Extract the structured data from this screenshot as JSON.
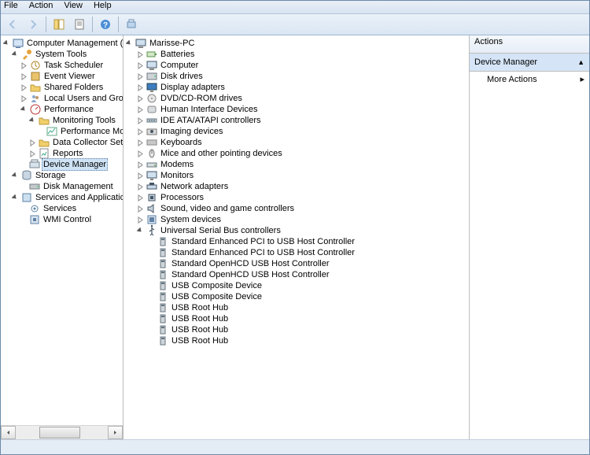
{
  "menu": {
    "file": "File",
    "action": "Action",
    "view": "View",
    "help": "Help"
  },
  "actions": {
    "header": "Actions",
    "section": "Device Manager",
    "more": "More Actions"
  },
  "left": {
    "root": "Computer Management (Local",
    "systools": "System Tools",
    "tasks": "Task Scheduler",
    "events": "Event Viewer",
    "shared": "Shared Folders",
    "users": "Local Users and Groups",
    "perf": "Performance",
    "montools": "Monitoring Tools",
    "perfmon": "Performance Mo",
    "datacol": "Data Collector Sets",
    "reports": "Reports",
    "devmgr": "Device Manager",
    "storage": "Storage",
    "diskmgmt": "Disk Management",
    "services": "Services and Applications",
    "svcs": "Services",
    "wmi": "WMI Control"
  },
  "center": {
    "root": "Marisse-PC",
    "cats": [
      "Batteries",
      "Computer",
      "Disk drives",
      "Display adapters",
      "DVD/CD-ROM drives",
      "Human Interface Devices",
      "IDE ATA/ATAPI controllers",
      "Imaging devices",
      "Keyboards",
      "Mice and other pointing devices",
      "Modems",
      "Monitors",
      "Network adapters",
      "Processors",
      "Sound, video and game controllers",
      "System devices",
      "Universal Serial Bus controllers"
    ],
    "usb": [
      "Standard Enhanced PCI to USB Host Controller",
      "Standard Enhanced PCI to USB Host Controller",
      "Standard OpenHCD USB Host Controller",
      "Standard OpenHCD USB Host Controller",
      "USB Composite Device",
      "USB Composite Device",
      "USB Root Hub",
      "USB Root Hub",
      "USB Root Hub",
      "USB Root Hub"
    ]
  }
}
